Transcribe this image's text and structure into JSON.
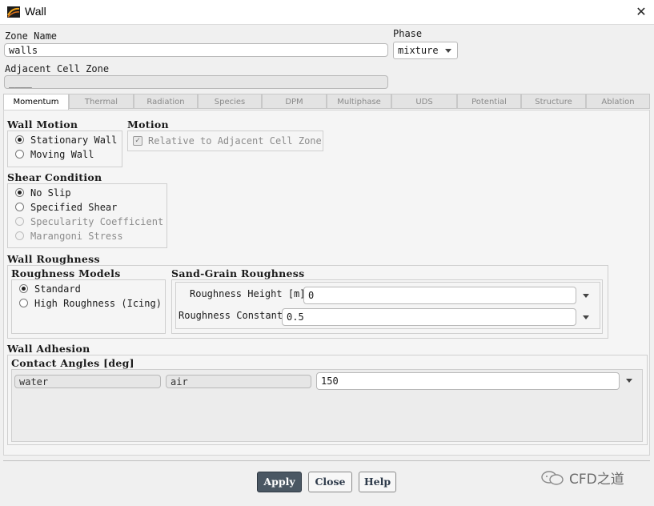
{
  "window": {
    "title": "Wall"
  },
  "zone_name": {
    "label": "Zone Name",
    "value": "walls"
  },
  "phase": {
    "label": "Phase",
    "value": "mixture"
  },
  "adjacent_cell_zone": {
    "label": "Adjacent Cell Zone",
    "value": "____"
  },
  "tabs": [
    "Momentum",
    "Thermal",
    "Radiation",
    "Species",
    "DPM",
    "Multiphase",
    "UDS",
    "Potential",
    "Structure",
    "Ablation"
  ],
  "active_tab": "Momentum",
  "wall_motion": {
    "title": "Wall Motion",
    "options": [
      "Stationary Wall",
      "Moving Wall"
    ],
    "selected": "Stationary Wall"
  },
  "motion": {
    "title": "Motion",
    "relative_label": "Relative to Adjacent Cell Zone",
    "relative_checked": true
  },
  "shear_condition": {
    "title": "Shear Condition",
    "options": [
      "No Slip",
      "Specified Shear",
      "Specularity Coefficient",
      "Marangoni Stress"
    ],
    "selected": "No Slip"
  },
  "wall_roughness": {
    "title": "Wall Roughness",
    "models_title": "Roughness Models",
    "models": [
      "Standard",
      "High Roughness (Icing)"
    ],
    "selected": "Standard",
    "sand_grain_title": "Sand-Grain Roughness",
    "height_label": "Roughness Height [m]",
    "height_value": "0",
    "constant_label": "Roughness Constant",
    "constant_value": "0.5"
  },
  "wall_adhesion": {
    "title": "Wall Adhesion",
    "contact_title": "Contact Angles [deg]",
    "phase1": "water",
    "phase2": "air",
    "angle": "150"
  },
  "buttons": {
    "apply": "Apply",
    "close": "Close",
    "help": "Help"
  },
  "watermark": "CFD之道",
  "icons": {
    "app": "fluent-logo-icon",
    "close": "close-icon",
    "dropdown": "chevron-down-icon",
    "watermark": "wechat-icon"
  },
  "colors": {
    "primary_button": "#4a5763",
    "background": "#f0f0f0"
  }
}
